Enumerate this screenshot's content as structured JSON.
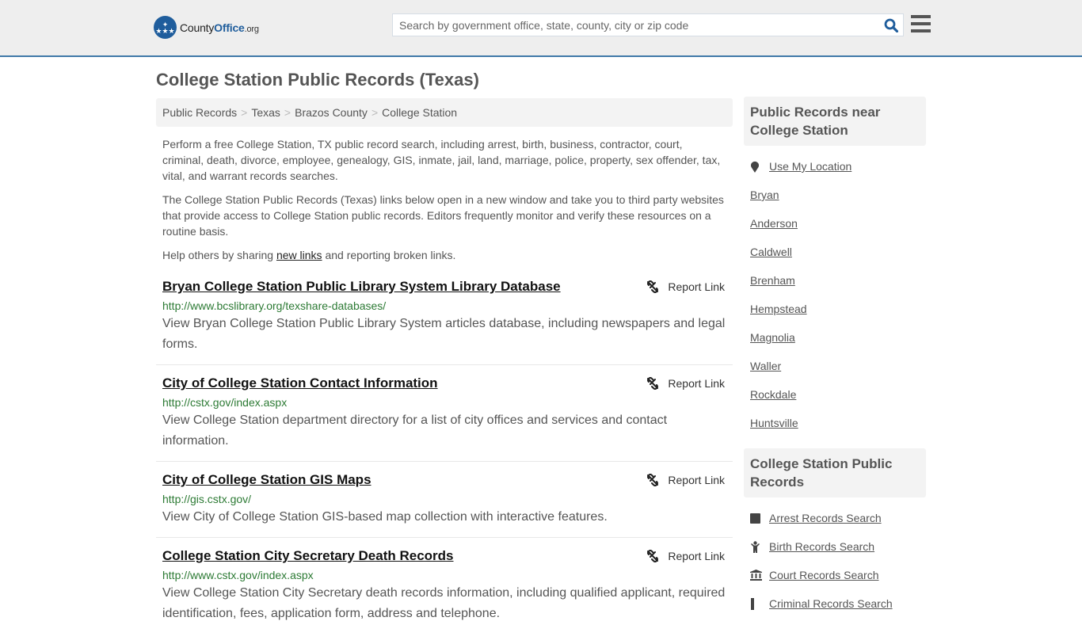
{
  "header": {
    "logo": {
      "county": "County",
      "office": "Office",
      "tld": ".org"
    },
    "search_placeholder": "Search by government office, state, county, city or zip code",
    "search_value": ""
  },
  "page_title": "College Station Public Records (Texas)",
  "breadcrumb": [
    "Public Records",
    "Texas",
    "Brazos County",
    "College Station"
  ],
  "breadcrumb_separator": ">",
  "intro": {
    "p1": "Perform a free College Station, TX public record search, including arrest, birth, business, contractor, court, criminal, death, divorce, employee, genealogy, GIS, inmate, jail, land, marriage, police, property, sex offender, tax, vital, and warrant records searches.",
    "p2": "The College Station Public Records (Texas) links below open in a new window and take you to third party websites that provide access to College Station public records. Editors frequently monitor and verify these resources on a routine basis.",
    "p3_before": "Help others by sharing ",
    "p3_link": "new links",
    "p3_after": " and reporting broken links."
  },
  "report_label": "Report Link",
  "records": [
    {
      "title": "Bryan College Station Public Library System Library Database",
      "url": "http://www.bcslibrary.org/texshare-databases/",
      "desc": "View Bryan College Station Public Library System articles database, including newspapers and legal forms."
    },
    {
      "title": "City of College Station Contact Information",
      "url": "http://cstx.gov/index.aspx",
      "desc": "View College Station department directory for a list of city offices and services and contact information."
    },
    {
      "title": "City of College Station GIS Maps",
      "url": "http://gis.cstx.gov/",
      "desc": "View City of College Station GIS-based map collection with interactive features."
    },
    {
      "title": "College Station City Secretary Death Records",
      "url": "http://www.cstx.gov/index.aspx",
      "desc": "View College Station City Secretary death records information, including qualified applicant, required identification, fees, application form, address and telephone."
    }
  ],
  "sidebar": {
    "nearby_title": "Public Records near College Station",
    "use_location": "Use My Location",
    "nearby": [
      "Bryan",
      "Anderson",
      "Caldwell",
      "Brenham",
      "Hempstead",
      "Magnolia",
      "Waller",
      "Rockdale",
      "Huntsville"
    ],
    "records_title": "College Station Public Records",
    "record_links": [
      {
        "label": "Arrest Records Search",
        "icon": "square-icon"
      },
      {
        "label": "Birth Records Search",
        "icon": "baby-icon"
      },
      {
        "label": "Court Records Search",
        "icon": "courthouse-icon"
      },
      {
        "label": "Criminal Records Search",
        "icon": "criminal-icon"
      }
    ]
  }
}
